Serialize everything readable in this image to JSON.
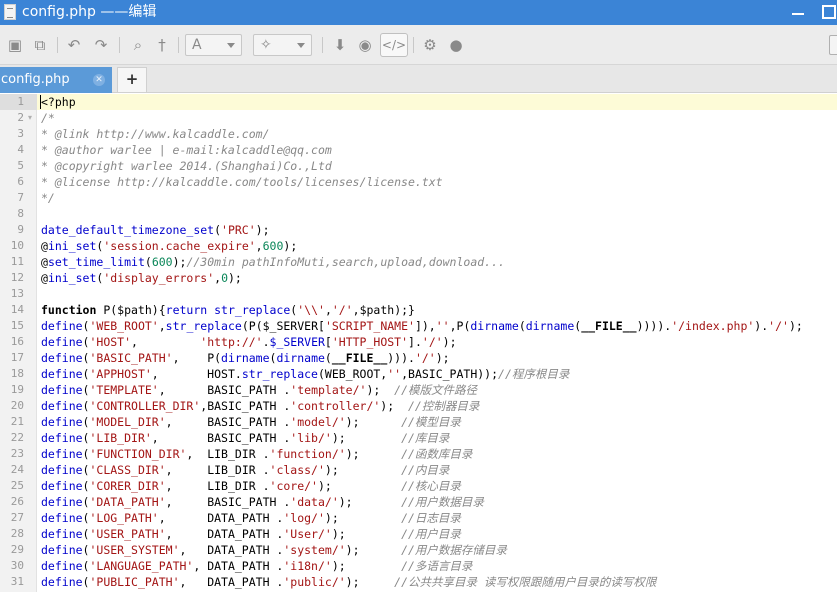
{
  "window": {
    "title": "config.php ——编辑"
  },
  "toolbar": {
    "buttons": [
      {
        "name": "save-icon",
        "glyph": "▣"
      },
      {
        "name": "save-all-icon",
        "glyph": "⧉"
      },
      {
        "name": "undo-icon",
        "glyph": "↶"
      },
      {
        "name": "redo-icon",
        "glyph": "↷"
      },
      {
        "name": "search-icon",
        "glyph": "⌕"
      },
      {
        "name": "pin-icon",
        "glyph": "†"
      },
      {
        "name": "font-icon",
        "glyph": "A"
      },
      {
        "name": "magic-wand-icon",
        "glyph": "✧"
      },
      {
        "name": "download-arrow-icon",
        "glyph": "⬇"
      },
      {
        "name": "preview-eye-icon",
        "glyph": "◉"
      },
      {
        "name": "code-view-icon",
        "glyph": "</>"
      },
      {
        "name": "gear-icon",
        "glyph": "⚙"
      },
      {
        "name": "globe-icon",
        "glyph": "●"
      }
    ]
  },
  "tabs": [
    {
      "label": "config.php",
      "active": true
    }
  ],
  "add_tab_label": "+",
  "tab_close_glyph": "✕",
  "editor": {
    "active_line": 1,
    "colors": {
      "comment": "#888888",
      "function": "#0000cc",
      "string": "#a31515",
      "number": "#098658",
      "keyword": "#000000",
      "active_line_bg": "#fdfbd7"
    },
    "lines": [
      {
        "n": "1",
        "fold": "",
        "tokens": [
          [
            "p",
            "<?php"
          ]
        ]
      },
      {
        "n": "2",
        "fold": "-",
        "tokens": [
          [
            "c",
            "/*"
          ]
        ]
      },
      {
        "n": "3",
        "fold": "",
        "tokens": [
          [
            "c",
            "* @link http://www.kalcaddle.com/"
          ]
        ]
      },
      {
        "n": "4",
        "fold": "",
        "tokens": [
          [
            "c",
            "* @author warlee | e-mail:kalcaddle@qq.com"
          ]
        ]
      },
      {
        "n": "5",
        "fold": "",
        "tokens": [
          [
            "c",
            "* @copyright warlee 2014.(Shanghai)Co.,Ltd"
          ]
        ]
      },
      {
        "n": "6",
        "fold": "",
        "tokens": [
          [
            "c",
            "* @license http://kalcaddle.com/tools/licenses/license.txt"
          ]
        ]
      },
      {
        "n": "7",
        "fold": "",
        "tokens": [
          [
            "c",
            "*/"
          ]
        ]
      },
      {
        "n": "8",
        "fold": "",
        "tokens": []
      },
      {
        "n": "9",
        "fold": "",
        "tokens": [
          [
            "f",
            "date_default_timezone_set"
          ],
          [
            "p",
            "("
          ],
          [
            "s",
            "'PRC'"
          ],
          [
            "p",
            ");"
          ]
        ]
      },
      {
        "n": "10",
        "fold": "",
        "tokens": [
          [
            "p",
            "@"
          ],
          [
            "f",
            "ini_set"
          ],
          [
            "p",
            "("
          ],
          [
            "s",
            "'session.cache_expire'"
          ],
          [
            "p",
            ","
          ],
          [
            "n",
            "600"
          ],
          [
            "p",
            ");"
          ]
        ]
      },
      {
        "n": "11",
        "fold": "",
        "tokens": [
          [
            "p",
            "@"
          ],
          [
            "f",
            "set_time_limit"
          ],
          [
            "p",
            "("
          ],
          [
            "n",
            "600"
          ],
          [
            "p",
            ");"
          ],
          [
            "c",
            "//30min pathInfoMuti,search,upload,download..."
          ]
        ]
      },
      {
        "n": "12",
        "fold": "",
        "tokens": [
          [
            "p",
            "@"
          ],
          [
            "f",
            "ini_set"
          ],
          [
            "p",
            "("
          ],
          [
            "s",
            "'display_errors'"
          ],
          [
            "p",
            ","
          ],
          [
            "n",
            "0"
          ],
          [
            "p",
            ");"
          ]
        ]
      },
      {
        "n": "13",
        "fold": "",
        "tokens": []
      },
      {
        "n": "14",
        "fold": "",
        "tokens": [
          [
            "k",
            "function"
          ],
          [
            "p",
            " P($path){"
          ],
          [
            "f",
            "return"
          ],
          [
            "p",
            " "
          ],
          [
            "f",
            "str_replace"
          ],
          [
            "p",
            "("
          ],
          [
            "s",
            "'\\\\'"
          ],
          [
            "p",
            ","
          ],
          [
            "s",
            "'/'"
          ],
          [
            "p",
            ",$path);}"
          ]
        ]
      },
      {
        "n": "15",
        "fold": "",
        "tokens": [
          [
            "f",
            "define"
          ],
          [
            "p",
            "("
          ],
          [
            "s",
            "'WEB_ROOT'"
          ],
          [
            "p",
            ","
          ],
          [
            "f",
            "str_replace"
          ],
          [
            "p",
            "(P($_SERVER["
          ],
          [
            "s",
            "'SCRIPT_NAME'"
          ],
          [
            "p",
            "]),"
          ],
          [
            "s",
            "''"
          ],
          [
            "p",
            ",P("
          ],
          [
            "f",
            "dirname"
          ],
          [
            "p",
            "("
          ],
          [
            "f",
            "dirname"
          ],
          [
            "p",
            "("
          ],
          [
            "k",
            "__FILE__"
          ],
          [
            "p",
            "))))."
          ],
          [
            "s",
            "'/index.php'"
          ],
          [
            "p",
            ")."
          ],
          [
            "s",
            "'/'"
          ],
          [
            "p",
            ");"
          ]
        ]
      },
      {
        "n": "16",
        "fold": "",
        "tokens": [
          [
            "f",
            "define"
          ],
          [
            "p",
            "("
          ],
          [
            "s",
            "'HOST'"
          ],
          [
            "p",
            ",         "
          ],
          [
            "s",
            "'http://'"
          ],
          [
            "p",
            "."
          ],
          [
            "f",
            "$_SERVER"
          ],
          [
            "p",
            "["
          ],
          [
            "s",
            "'HTTP_HOST'"
          ],
          [
            "p",
            "]."
          ],
          [
            "s",
            "'/'"
          ],
          [
            "p",
            ");"
          ]
        ]
      },
      {
        "n": "17",
        "fold": "",
        "tokens": [
          [
            "f",
            "define"
          ],
          [
            "p",
            "("
          ],
          [
            "s",
            "'BASIC_PATH'"
          ],
          [
            "p",
            ",    P("
          ],
          [
            "f",
            "dirname"
          ],
          [
            "p",
            "("
          ],
          [
            "f",
            "dirname"
          ],
          [
            "p",
            "("
          ],
          [
            "k",
            "__FILE__"
          ],
          [
            "p",
            ")))."
          ],
          [
            "s",
            "'/'"
          ],
          [
            "p",
            ");"
          ]
        ]
      },
      {
        "n": "18",
        "fold": "",
        "tokens": [
          [
            "f",
            "define"
          ],
          [
            "p",
            "("
          ],
          [
            "s",
            "'APPHOST'"
          ],
          [
            "p",
            ",       HOST."
          ],
          [
            "f",
            "str_replace"
          ],
          [
            "p",
            "(WEB_ROOT,"
          ],
          [
            "s",
            "''"
          ],
          [
            "p",
            ",BASIC_PATH));"
          ],
          [
            "c",
            "//程序根目录"
          ]
        ]
      },
      {
        "n": "19",
        "fold": "",
        "tokens": [
          [
            "f",
            "define"
          ],
          [
            "p",
            "("
          ],
          [
            "s",
            "'TEMPLATE'"
          ],
          [
            "p",
            ",      BASIC_PATH ."
          ],
          [
            "s",
            "'template/'"
          ],
          [
            "p",
            ");  "
          ],
          [
            "c",
            "//模版文件路径"
          ]
        ]
      },
      {
        "n": "20",
        "fold": "",
        "tokens": [
          [
            "f",
            "define"
          ],
          [
            "p",
            "("
          ],
          [
            "s",
            "'CONTROLLER_DIR'"
          ],
          [
            "p",
            ",BASIC_PATH ."
          ],
          [
            "s",
            "'controller/'"
          ],
          [
            "p",
            ");  "
          ],
          [
            "c",
            "//控制器目录"
          ]
        ]
      },
      {
        "n": "21",
        "fold": "",
        "tokens": [
          [
            "f",
            "define"
          ],
          [
            "p",
            "("
          ],
          [
            "s",
            "'MODEL_DIR'"
          ],
          [
            "p",
            ",     BASIC_PATH ."
          ],
          [
            "s",
            "'model/'"
          ],
          [
            "p",
            ");      "
          ],
          [
            "c",
            "//模型目录"
          ]
        ]
      },
      {
        "n": "22",
        "fold": "",
        "tokens": [
          [
            "f",
            "define"
          ],
          [
            "p",
            "("
          ],
          [
            "s",
            "'LIB_DIR'"
          ],
          [
            "p",
            ",       BASIC_PATH ."
          ],
          [
            "s",
            "'lib/'"
          ],
          [
            "p",
            ");        "
          ],
          [
            "c",
            "//库目录"
          ]
        ]
      },
      {
        "n": "23",
        "fold": "",
        "tokens": [
          [
            "f",
            "define"
          ],
          [
            "p",
            "("
          ],
          [
            "s",
            "'FUNCTION_DIR'"
          ],
          [
            "p",
            ",  LIB_DIR ."
          ],
          [
            "s",
            "'function/'"
          ],
          [
            "p",
            ");      "
          ],
          [
            "c",
            "//函数库目录"
          ]
        ]
      },
      {
        "n": "24",
        "fold": "",
        "tokens": [
          [
            "f",
            "define"
          ],
          [
            "p",
            "("
          ],
          [
            "s",
            "'CLASS_DIR'"
          ],
          [
            "p",
            ",     LIB_DIR ."
          ],
          [
            "s",
            "'class/'"
          ],
          [
            "p",
            ");         "
          ],
          [
            "c",
            "//内目录"
          ]
        ]
      },
      {
        "n": "25",
        "fold": "",
        "tokens": [
          [
            "f",
            "define"
          ],
          [
            "p",
            "("
          ],
          [
            "s",
            "'CORER_DIR'"
          ],
          [
            "p",
            ",     LIB_DIR ."
          ],
          [
            "s",
            "'core/'"
          ],
          [
            "p",
            ");          "
          ],
          [
            "c",
            "//核心目录"
          ]
        ]
      },
      {
        "n": "26",
        "fold": "",
        "tokens": [
          [
            "f",
            "define"
          ],
          [
            "p",
            "("
          ],
          [
            "s",
            "'DATA_PATH'"
          ],
          [
            "p",
            ",     BASIC_PATH ."
          ],
          [
            "s",
            "'data/'"
          ],
          [
            "p",
            ");       "
          ],
          [
            "c",
            "//用户数据目录"
          ]
        ]
      },
      {
        "n": "27",
        "fold": "",
        "tokens": [
          [
            "f",
            "define"
          ],
          [
            "p",
            "("
          ],
          [
            "s",
            "'LOG_PATH'"
          ],
          [
            "p",
            ",      DATA_PATH ."
          ],
          [
            "s",
            "'log/'"
          ],
          [
            "p",
            ");         "
          ],
          [
            "c",
            "//日志目录"
          ]
        ]
      },
      {
        "n": "28",
        "fold": "",
        "tokens": [
          [
            "f",
            "define"
          ],
          [
            "p",
            "("
          ],
          [
            "s",
            "'USER_PATH'"
          ],
          [
            "p",
            ",     DATA_PATH ."
          ],
          [
            "s",
            "'User/'"
          ],
          [
            "p",
            ");        "
          ],
          [
            "c",
            "//用户目录"
          ]
        ]
      },
      {
        "n": "29",
        "fold": "",
        "tokens": [
          [
            "f",
            "define"
          ],
          [
            "p",
            "("
          ],
          [
            "s",
            "'USER_SYSTEM'"
          ],
          [
            "p",
            ",   DATA_PATH ."
          ],
          [
            "s",
            "'system/'"
          ],
          [
            "p",
            ");      "
          ],
          [
            "c",
            "//用户数据存储目录"
          ]
        ]
      },
      {
        "n": "30",
        "fold": "",
        "tokens": [
          [
            "f",
            "define"
          ],
          [
            "p",
            "("
          ],
          [
            "s",
            "'LANGUAGE_PATH'"
          ],
          [
            "p",
            ", DATA_PATH ."
          ],
          [
            "s",
            "'i18n/'"
          ],
          [
            "p",
            ");        "
          ],
          [
            "c",
            "//多语言目录"
          ]
        ]
      },
      {
        "n": "31",
        "fold": "",
        "tokens": [
          [
            "f",
            "define"
          ],
          [
            "p",
            "("
          ],
          [
            "s",
            "'PUBLIC_PATH'"
          ],
          [
            "p",
            ",   DATA_PATH ."
          ],
          [
            "s",
            "'public/'"
          ],
          [
            "p",
            ");     "
          ],
          [
            "c",
            "//公共共享目录 读写权限跟随用户目录的读写权限"
          ]
        ]
      }
    ]
  }
}
